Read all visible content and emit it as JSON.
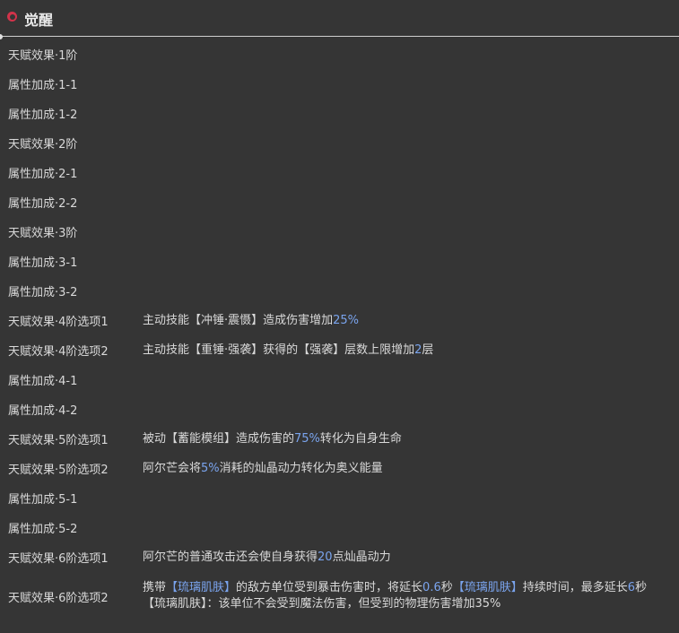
{
  "title": "觉醒",
  "colors": {
    "background": "#353535",
    "text": "#d9d9d9",
    "highlight": "#7aa4ee",
    "icon": "#d2334a"
  },
  "rows": [
    {
      "label": "天赋效果·1阶",
      "desc": []
    },
    {
      "label": "属性加成·1-1",
      "desc": []
    },
    {
      "label": "属性加成·1-2",
      "desc": []
    },
    {
      "label": "天赋效果·2阶",
      "desc": []
    },
    {
      "label": "属性加成·2-1",
      "desc": []
    },
    {
      "label": "属性加成·2-2",
      "desc": []
    },
    {
      "label": "天赋效果·3阶",
      "desc": []
    },
    {
      "label": "属性加成·3-1",
      "desc": []
    },
    {
      "label": "属性加成·3-2",
      "desc": []
    },
    {
      "label": "天赋效果·4阶选项1",
      "desc": [
        [
          {
            "t": "主动技能【冲锤·震慑】造成伤害增加"
          },
          {
            "t": "25%",
            "hl": true
          }
        ]
      ]
    },
    {
      "label": "天赋效果·4阶选项2",
      "desc": [
        [
          {
            "t": "主动技能【重锤·强袭】获得的【强袭】层数上限增加"
          },
          {
            "t": "2",
            "hl": true
          },
          {
            "t": "层"
          }
        ]
      ]
    },
    {
      "label": "属性加成·4-1",
      "desc": []
    },
    {
      "label": "属性加成·4-2",
      "desc": []
    },
    {
      "label": "天赋效果·5阶选项1",
      "desc": [
        [
          {
            "t": "被动【蓄能模组】造成伤害的"
          },
          {
            "t": "75%",
            "hl": true
          },
          {
            "t": "转化为自身生命"
          }
        ]
      ]
    },
    {
      "label": "天赋效果·5阶选项2",
      "desc": [
        [
          {
            "t": "阿尔芒会将"
          },
          {
            "t": "5%",
            "hl": true
          },
          {
            "t": "消耗的灿晶动力转化为奥义能量"
          }
        ]
      ]
    },
    {
      "label": "属性加成·5-1",
      "desc": []
    },
    {
      "label": "属性加成·5-2",
      "desc": []
    },
    {
      "label": "天赋效果·6阶选项1",
      "desc": [
        [
          {
            "t": "阿尔芒的普通攻击还会使自身获得"
          },
          {
            "t": "20",
            "hl": true
          },
          {
            "t": "点灿晶动力"
          }
        ]
      ]
    },
    {
      "label": "天赋效果·6阶选项2",
      "tall": true,
      "desc": [
        [
          {
            "t": "携带"
          },
          {
            "t": "【琉璃肌肤】",
            "hl": true
          },
          {
            "t": "的敌方单位受到暴击伤害时，将延长"
          },
          {
            "t": "0.6",
            "hl": true
          },
          {
            "t": "秒"
          },
          {
            "t": "【琉璃肌肤】",
            "hl": true
          },
          {
            "t": "持续时间，最多延长"
          },
          {
            "t": "6",
            "hl": true
          },
          {
            "t": "秒"
          }
        ],
        [
          {
            "t": "【琉璃肌肤】：该单位不会受到魔法伤害，但受到的物理伤害增加35%"
          }
        ]
      ]
    }
  ]
}
